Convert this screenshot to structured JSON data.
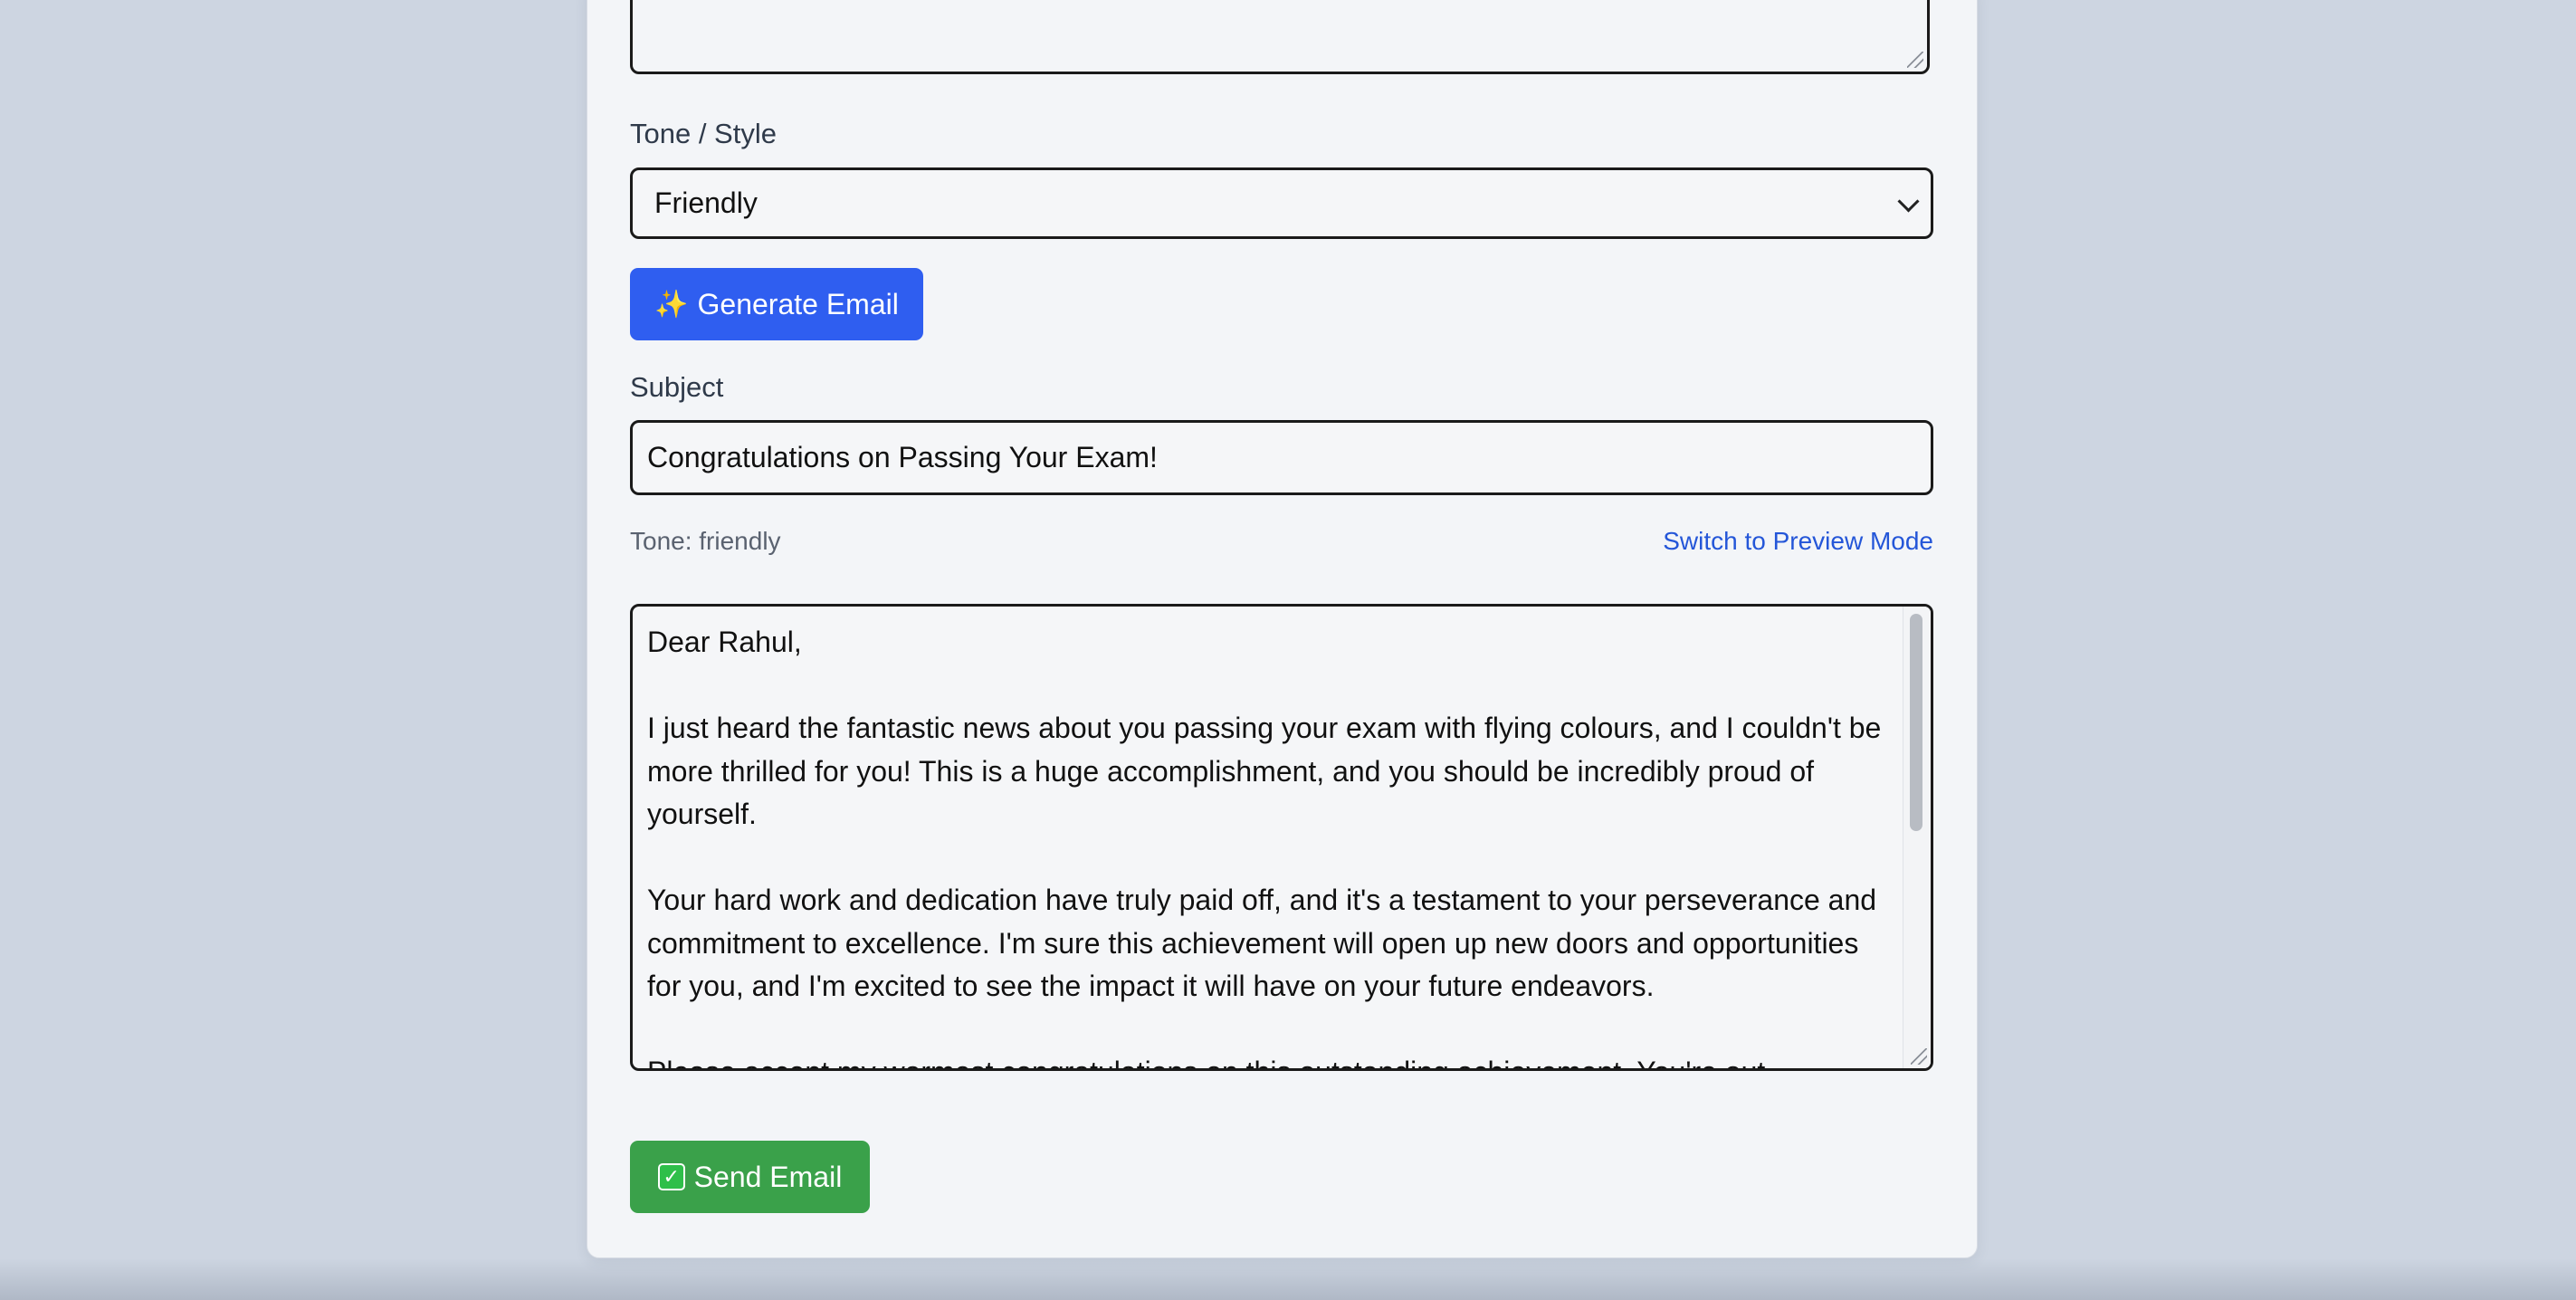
{
  "form": {
    "tone_label": "Tone / Style",
    "tone_selected": "Friendly",
    "generate_label": "Generate Email",
    "subject_label": "Subject",
    "subject_value": "Congratulations on Passing Your Exam!",
    "tone_status": "Tone: friendly",
    "preview_link": "Switch to Preview Mode",
    "body_paragraphs": [
      "Dear Rahul,",
      "I just heard the fantastic news about you passing your exam with flying colours, and I couldn't be more thrilled for you! This is a huge accomplishment, and you should be incredibly proud of yourself.",
      "Your hard work and dedication have truly paid off, and it's a testament to your perseverance and commitment to excellence. I'm sure this achievement will open up new doors and opportunities for you, and I'm excited to see the impact it will have on your future endeavors.",
      "Please accept my warmest congratulations on this outstanding achievement. You're out"
    ],
    "send_label": "Send Email"
  },
  "icons": {
    "generate": "sparkles-icon",
    "send": "check-mark-button-icon",
    "select": "chevron-down-icon"
  },
  "colors": {
    "background": "#cdd5e1",
    "card": "#f3f5f8",
    "primary_button": "#2f5ef0",
    "success_button": "#3aa14a",
    "link": "#2456d8"
  }
}
